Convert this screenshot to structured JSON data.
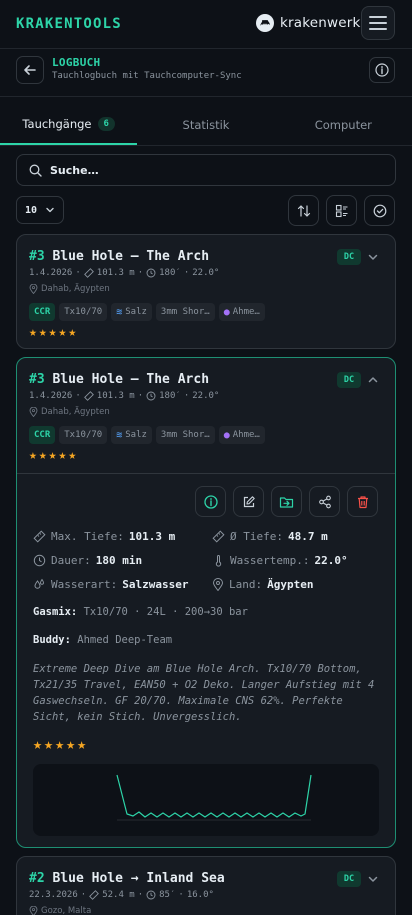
{
  "app": {
    "brand": "KRAKENTOOLS",
    "partner": "krakenwerk"
  },
  "header": {
    "title": "LOGBUCH",
    "subtitle": "Tauchlogbuch mit Tauchcomputer-Sync"
  },
  "tabs": [
    {
      "label": "Tauchgänge",
      "badge": "6",
      "active": true
    },
    {
      "label": "Statistik",
      "active": false
    },
    {
      "label": "Computer",
      "active": false
    }
  ],
  "search": {
    "placeholder": "Suche…"
  },
  "page_size": {
    "selected": "10"
  },
  "cards": [
    {
      "num": "#3",
      "title": "Blue Hole – The Arch",
      "badge": "DC",
      "date": "1.4.2026",
      "depth": "101.3 m",
      "duration": "180′",
      "temp": "22.0°",
      "location": "Dahab, Ägypten",
      "tags": [
        "CCR",
        "Tx10/70",
        "Salz",
        "3mm Shor…",
        "Ahme…"
      ],
      "rating": 5
    },
    {
      "num": "#3",
      "title": "Blue Hole – The Arch",
      "badge": "DC",
      "date": "1.4.2026",
      "depth": "101.3 m",
      "duration": "180′",
      "temp": "22.0°",
      "location": "Dahab, Ägypten",
      "tags": [
        "CCR",
        "Tx10/70",
        "Salz",
        "3mm Shor…",
        "Ahme…"
      ],
      "rating": 5,
      "details": {
        "max_depth_label": "Max. Tiefe:",
        "max_depth": "101.3 m",
        "avg_depth_label": "Ø Tiefe:",
        "avg_depth": "48.7 m",
        "duration_label": "Dauer:",
        "duration": "180 min",
        "water_temp_label": "Wassertemp.:",
        "water_temp": "22.0°",
        "water_type_label": "Wasserart:",
        "water_type": "Salzwasser",
        "country_label": "Land:",
        "country": "Ägypten",
        "gas_label": "Gasmix:",
        "gas": "Tx10/70 · 24L · 200→30 bar",
        "buddy_label": "Buddy:",
        "buddy": "Ahmed Deep-Team",
        "notes": "Extreme Deep Dive am Blue Hole Arch. Tx10/70 Bottom, Tx21/35 Travel, EAN50 + O2 Deko. Langer Aufstieg mit 4 Gaswechseln. GF 20/70. Maximale CNS 62%. Perfekte Sicht, kein Stich. Unvergesslich."
      }
    },
    {
      "num": "#2",
      "title": "Blue Hole → Inland Sea",
      "badge": "DC",
      "date": "22.3.2026",
      "depth": "52.4 m",
      "duration": "85′",
      "temp": "16.0°",
      "location": "Gozo, Malta"
    }
  ],
  "colors": {
    "accent": "#2dd4a8",
    "danger": "#f85149",
    "star": "#f5a623",
    "background": "#0d1117",
    "card": "#161b22"
  }
}
